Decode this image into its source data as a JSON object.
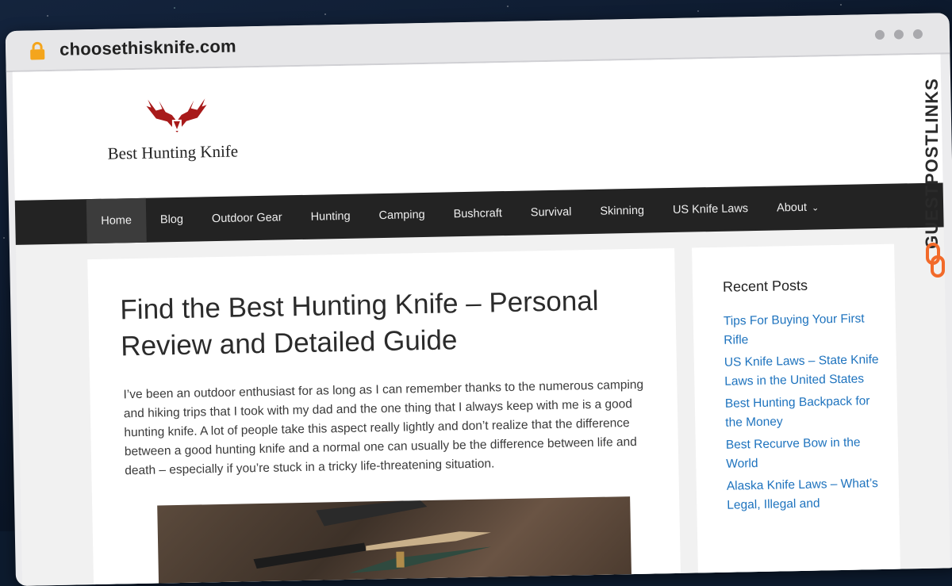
{
  "browser": {
    "url": "choosethisknife.com"
  },
  "site": {
    "logo_text": "Best Hunting Knife",
    "brand_color": "#a81a1a"
  },
  "nav": {
    "items": [
      {
        "label": "Home",
        "active": true
      },
      {
        "label": "Blog"
      },
      {
        "label": "Outdoor Gear"
      },
      {
        "label": "Hunting"
      },
      {
        "label": "Camping"
      },
      {
        "label": "Bushcraft"
      },
      {
        "label": "Survival"
      },
      {
        "label": "Skinning"
      },
      {
        "label": "US Knife Laws"
      },
      {
        "label": "About"
      }
    ]
  },
  "article": {
    "title": "Find the Best Hunting Knife – Personal Review and Detailed Guide",
    "intro": "I’ve been an outdoor enthusiast for as long as I can remember thanks to the numerous camping and hiking trips that I took with my dad and the one thing that I always keep with me is a good hunting knife. A lot of people take this aspect really lightly and don’t realize that the difference between a good hunting knife and a normal one can usually be the difference between life and death – especially if you’re stuck in a tricky life-threatening situation."
  },
  "sidebar": {
    "widget_title": "Recent Posts",
    "posts": [
      "Tips For Buying Your First Rifle",
      "US Knife Laws – State Knife Laws in the United States",
      "Best Hunting Backpack for the Money",
      "Best Recurve Bow in the World",
      "Alaska Knife Laws – What’s Legal, Illegal and"
    ]
  },
  "watermark": {
    "text": "GUESTPOSTLINKS",
    "accent_color": "#f26a2a"
  }
}
